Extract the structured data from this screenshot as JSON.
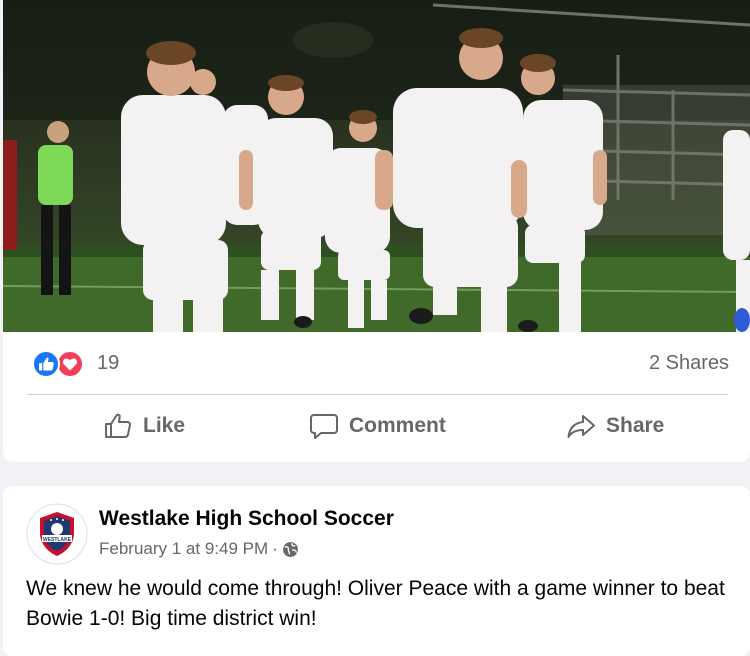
{
  "post": {
    "reactions": {
      "count": "19",
      "icons": [
        "like-icon",
        "love-icon"
      ]
    },
    "shares": "2 Shares",
    "actions": {
      "like": "Like",
      "comment": "Comment",
      "share": "Share"
    }
  },
  "next_post": {
    "page_name": "Westlake High School Soccer",
    "timestamp": "February 1 at 9:49 PM",
    "separator": "·",
    "privacy": "globe-icon",
    "text": "We knew he would come through! Oliver Peace with a game winner to beat Bowie 1-0! Big time district win!"
  },
  "colors": {
    "like_blue": "#1877f2",
    "love_red": "#f33e58",
    "secondary_text": "#65676b",
    "feed_bg": "#f0f2f5",
    "logo_red": "#c8102e",
    "logo_navy": "#1f3a70"
  }
}
